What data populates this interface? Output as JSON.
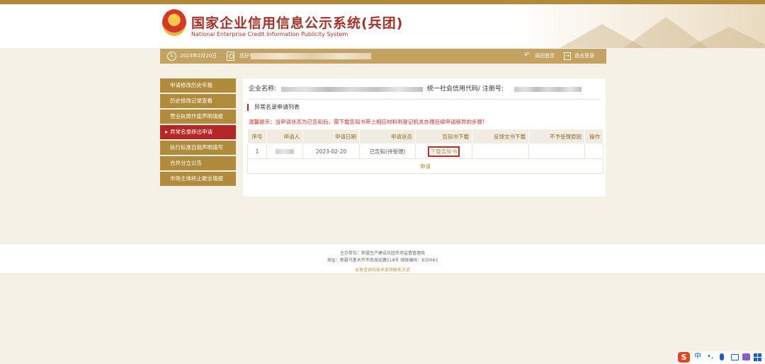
{
  "header": {
    "title": "国家企业信用信息公示系统(兵团)",
    "subtitle": "National Enterprise Credit Information Publicity System"
  },
  "infobar": {
    "date": "2023年2月20日",
    "greeting": "您好！",
    "home_link": "返回首页",
    "logout_link": "退出登录"
  },
  "sidebar": {
    "items": [
      {
        "label": "申请修改历史年报",
        "active": false
      },
      {
        "label": "历史修改记录查看",
        "active": false
      },
      {
        "label": "营业执照作废声明填报",
        "active": false
      },
      {
        "label": "异常名录移出申请",
        "active": true
      },
      {
        "label": "执行标准自我声明填写",
        "active": false
      },
      {
        "label": "合并分立公告",
        "active": false
      },
      {
        "label": "市场主体终止歇业填报",
        "active": false
      }
    ]
  },
  "main": {
    "company_label": "企业名称:",
    "credit_code_label": "统一社会信用代码/ 注册号:",
    "section_title": "异常名录申请列表",
    "tip": "温馨提示：当申请状态为已告知后，需下载告知书带上相应材料到登记机关办理后续申请移异的步骤!",
    "table": {
      "headers": [
        "序号",
        "申请人",
        "申请日期",
        "申请状态",
        "告知书下载",
        "反馈文书下载",
        "不予受理原因",
        "操作"
      ],
      "rows": [
        {
          "index": "1",
          "date": "2023-02-20",
          "status": "已告知(待受理)",
          "download": "下载告知书"
        }
      ],
      "apply_label": "申请"
    }
  },
  "footer": {
    "sponsor": "主办单位：新疆生产建设兵团市场监督管理局",
    "address": "地址：新疆乌鲁木齐市南湖北路518号 邮政编码：830063",
    "support_link": "业务咨询与技术支持联系方式"
  },
  "ime": {
    "logo": "S",
    "lang": "中",
    "punct": "•,"
  },
  "colors": {
    "gold": "#b08b3c",
    "active_red": "#b52626",
    "tip_red": "#d22b2b",
    "title_red": "#a1332a"
  }
}
